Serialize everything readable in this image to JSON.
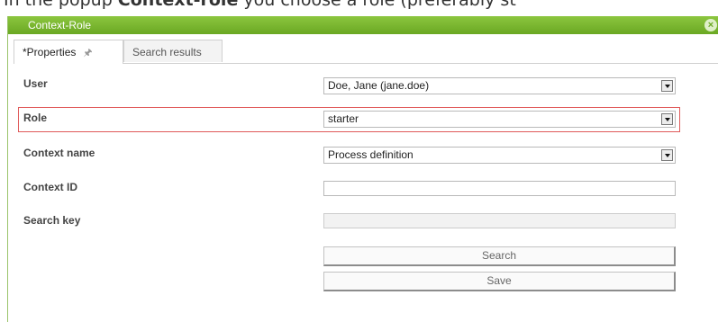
{
  "top_clip": {
    "before": "In the popup ",
    "bold": "Context-role",
    "after": " you choose a role (preferably st"
  },
  "dialog": {
    "title": "Context-Role",
    "close_symbol": "×"
  },
  "tabs": [
    {
      "label": "*Properties",
      "active": true
    },
    {
      "label": "Search results",
      "active": false
    }
  ],
  "form": {
    "user_label": "User",
    "user_value": "Doe, Jane (jane.doe)",
    "role_label": "Role",
    "role_value": "starter",
    "context_name_label": "Context name",
    "context_name_value": "Process definition",
    "context_id_label": "Context ID",
    "context_id_value": "",
    "search_key_label": "Search key",
    "search_key_value": ""
  },
  "buttons": {
    "search": "Search",
    "save": "Save"
  },
  "colors": {
    "title_bar": "#8cc63f",
    "highlight": "#e05a5a"
  }
}
